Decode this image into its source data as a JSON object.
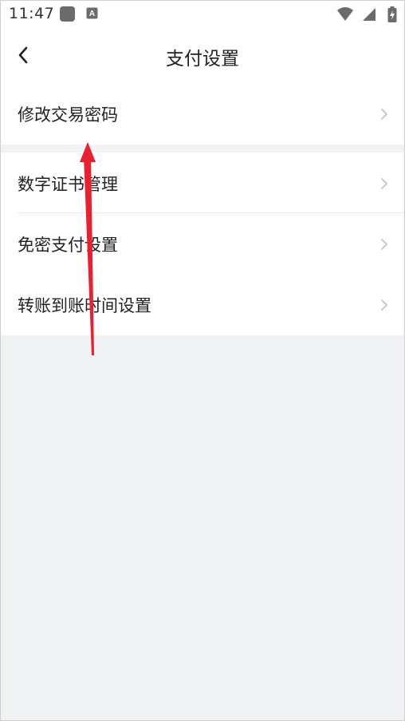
{
  "status_bar": {
    "time": "11:47",
    "icons": [
      "app-notification-icon",
      "keyboard-a-icon",
      "wifi-icon",
      "cell-signal-icon",
      "battery-charging-icon"
    ]
  },
  "header": {
    "title": "支付设置",
    "back_icon": "chevron-left-icon"
  },
  "settings": {
    "group1": [
      {
        "label": "修改交易密码"
      }
    ],
    "group2": [
      {
        "label": "数字证书管理"
      },
      {
        "label": "免密支付设置"
      },
      {
        "label": "转账到账时间设置"
      }
    ]
  },
  "annotation": {
    "color": "#e8202f",
    "type": "arrow"
  },
  "colors": {
    "background": "#f1f2f4",
    "surface": "#ffffff",
    "chevron": "#c4c4c4"
  }
}
